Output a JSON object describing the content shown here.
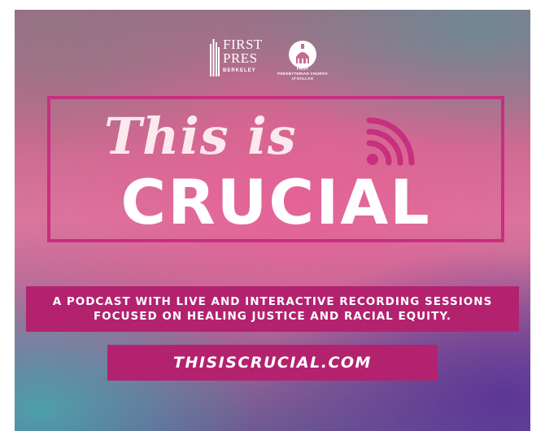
{
  "colors": {
    "accent": "#b3226e",
    "frame": "#c72f7f",
    "title_text": "#fbe9ee",
    "signal_icon": "#c72f7f"
  },
  "logos": {
    "first_pres": {
      "line1": "FIRST",
      "line2": "PRES",
      "sub": "BERKELEY"
    },
    "dallas": {
      "line1": "FIRST",
      "line2": "PRESBYTERIAN CHURCH",
      "line3": "of DALLAS"
    }
  },
  "title": {
    "line1": "This is",
    "line2": "CRUCIAL",
    "icon": "signal-icon"
  },
  "description": {
    "line1": "A PODCAST WITH LIVE AND INTERACTIVE RECORDING SESSIONS",
    "line2": "FOCUSED ON HEALING JUSTICE AND RACIAL EQUITY."
  },
  "website": {
    "url": "THISISCRUCIAL.COM"
  }
}
